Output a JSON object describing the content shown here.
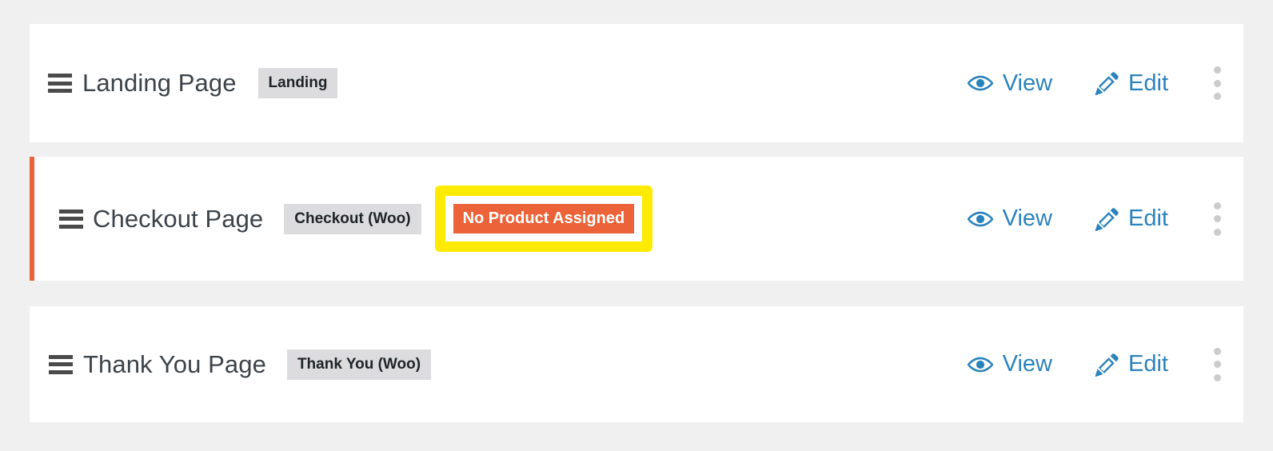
{
  "theme": {
    "page_background": "#f0f0f1",
    "row_background": "#ffffff",
    "accent_blue": "#2a83bd",
    "accent_orange": "#ec6339",
    "highlight_yellow": "#ffeb00",
    "badge_gray": "#dcdcde",
    "title_color": "#3c434a",
    "kebab_gray": "#cccccc"
  },
  "steps": [
    {
      "drag_handle_icon": "hamburger-drag-icon",
      "title": "Landing Page",
      "type_badge": "Landing",
      "warning_badge": null,
      "highlighted": false,
      "actions": {
        "view_icon": "eye-icon",
        "view_label": "View",
        "edit_icon": "pencil-icon",
        "edit_label": "Edit",
        "more_icon": "kebab-menu-icon"
      }
    },
    {
      "drag_handle_icon": "hamburger-drag-icon",
      "title": "Checkout Page",
      "type_badge": "Checkout (Woo)",
      "warning_badge": "No Product Assigned",
      "highlighted": true,
      "actions": {
        "view_icon": "eye-icon",
        "view_label": "View",
        "edit_icon": "pencil-icon",
        "edit_label": "Edit",
        "more_icon": "kebab-menu-icon"
      }
    },
    {
      "drag_handle_icon": "hamburger-drag-icon",
      "title": "Thank You Page",
      "type_badge": "Thank You (Woo)",
      "warning_badge": null,
      "highlighted": false,
      "actions": {
        "view_icon": "eye-icon",
        "view_label": "View",
        "edit_icon": "pencil-icon",
        "edit_label": "Edit",
        "more_icon": "kebab-menu-icon"
      }
    }
  ]
}
